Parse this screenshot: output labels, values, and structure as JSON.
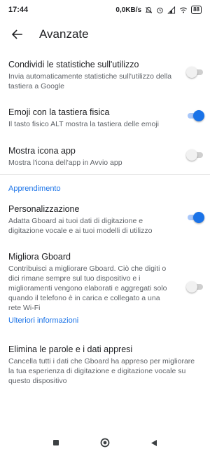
{
  "status_bar": {
    "time": "17:44",
    "network_speed": "0,0KB/s",
    "battery": "88"
  },
  "app_bar": {
    "back_icon": "arrow-back-icon",
    "title": "Avanzate"
  },
  "settings": {
    "share_stats": {
      "title": "Condividi le statistiche sull'utilizzo",
      "desc": "Invia automaticamente statistiche sull'utilizzo della tastiera a Google",
      "enabled": false
    },
    "emoji_physical": {
      "title": "Emoji con la tastiera fisica",
      "desc": "Il tasto fisico ALT mostra la tastiera delle emoji",
      "enabled": true
    },
    "show_app_icon": {
      "title": "Mostra icona app",
      "desc": "Mostra l'icona dell'app in Avvio app",
      "enabled": false
    }
  },
  "learning": {
    "header": "Apprendimento",
    "personalization": {
      "title": "Personalizzazione",
      "desc": "Adatta Gboard ai tuoi dati di digitazione e digitazione vocale e ai tuoi modelli di utilizzo",
      "enabled": true
    },
    "improve_gboard": {
      "title": "Migliora Gboard",
      "desc": "Contribuisci a migliorare Gboard. Ciò che digiti o dici rimane sempre sul tuo dispositivo e i miglioramenti vengono elaborati e aggregati solo quando il telefono è in carica e collegato a una rete Wi-Fi",
      "enabled": false
    },
    "more_info": "Ulteriori informazioni",
    "delete_learned": {
      "title": "Elimina le parole e i dati appresi",
      "desc": "Cancella tutti i dati che Gboard ha appreso per migliorare la tua esperienza di digitazione e digitazione vocale su questo dispositivo"
    }
  },
  "colors": {
    "accent": "#1a73e8",
    "toggle_on_track": "#a8c7fa",
    "text_primary": "#202124",
    "text_secondary": "#5f6368"
  },
  "nav": {
    "recents_icon": "square-icon",
    "home_icon": "circle-icon",
    "back_icon": "triangle-back-icon"
  }
}
